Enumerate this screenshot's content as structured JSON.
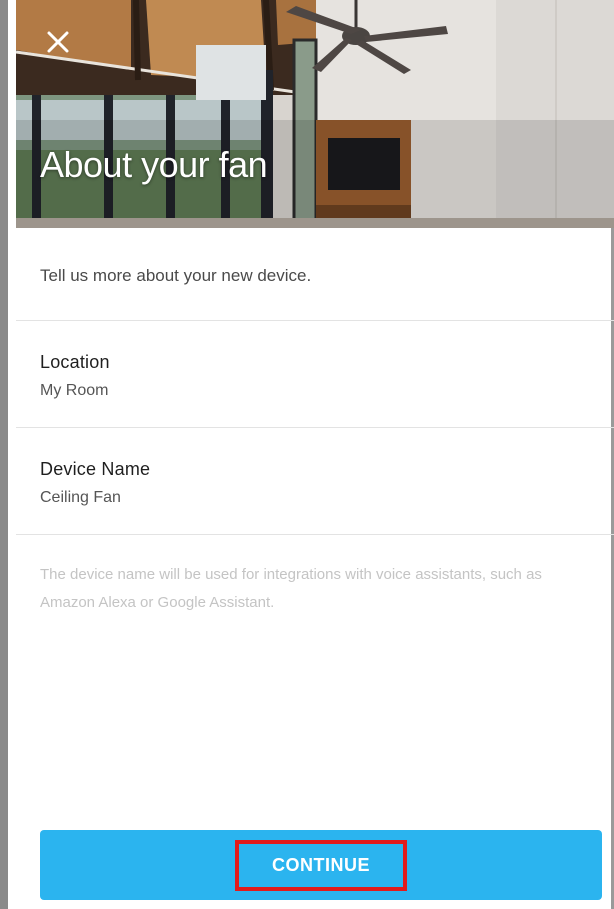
{
  "header": {
    "title": "About your fan",
    "close_icon": "close-icon"
  },
  "intro_text": "Tell us more about your new device.",
  "fields": [
    {
      "label": "Location",
      "value": "My Room"
    },
    {
      "label": "Device Name",
      "value": "Ceiling Fan"
    }
  ],
  "help_text": "The device name will be used for integrations with voice assistants, such as Amazon Alexa or Google Assistant.",
  "continue_button": {
    "label": "CONTINUE"
  },
  "colors": {
    "primary_button": "#2bb4ef",
    "highlight_box": "#e21b1b",
    "help_text": "#c4c4c4"
  }
}
